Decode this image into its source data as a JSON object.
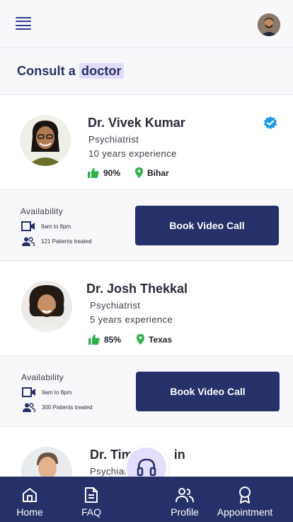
{
  "header": {
    "menu_icon": "hamburger-menu-icon",
    "avatar_icon": "user-avatar"
  },
  "page": {
    "title_prefix": "Consult a",
    "title_highlight": "doctor"
  },
  "doctors": [
    {
      "name": "Dr. Vivek Kumar",
      "specialty": "Psychiatrist",
      "experience": "10 years experience",
      "rating": "90%",
      "location": "Bihar",
      "verified": true,
      "availability_label": "Availability",
      "hours": "9am to 8pm",
      "patients": "121 Patients treated",
      "cta": "Book Video Call"
    },
    {
      "name": "Dr. Josh Thekkal",
      "specialty": "Psychiatrist",
      "experience": "5 years experience",
      "rating": "85%",
      "location": "Texas",
      "verified": false,
      "availability_label": "Availability",
      "hours": "9am to 8pm",
      "patients": "300 Patients treated",
      "cta": "Book Video Call"
    },
    {
      "name": "Dr. Tim",
      "name_tail": "in",
      "specialty": "Psychiat"
    }
  ],
  "nav": {
    "items": [
      {
        "label": "Home",
        "icon": "home-icon"
      },
      {
        "label": "FAQ",
        "icon": "document-icon"
      },
      {
        "label": "Profile",
        "icon": "users-icon"
      },
      {
        "label": "Appointment",
        "icon": "award-icon"
      }
    ],
    "support_icon": "headphones-icon"
  },
  "colors": {
    "primary": "#253168",
    "highlight": "#e1dcfb",
    "success": "#2fb14a",
    "verified": "#1e9ae6"
  }
}
